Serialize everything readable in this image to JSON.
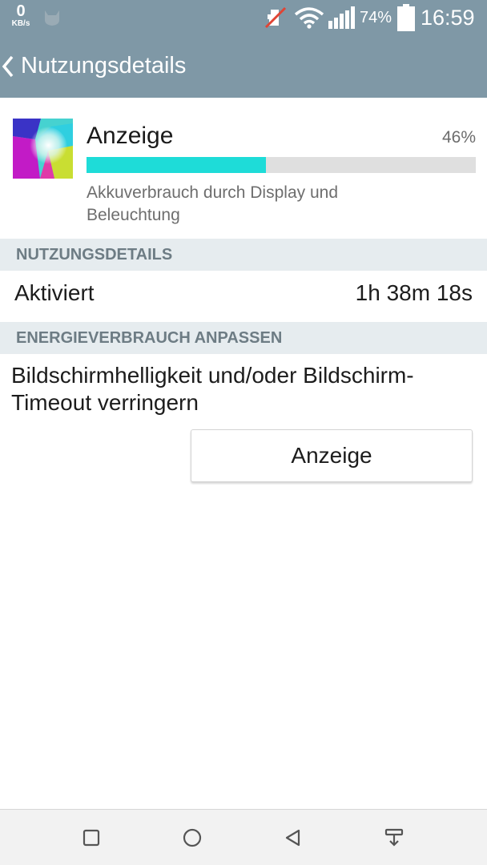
{
  "status_bar": {
    "speed_value": "0",
    "speed_unit": "KB/s",
    "battery_percent": "74%",
    "time": "16:59",
    "icons": [
      "cat-icon",
      "mute-icon",
      "wifi-icon",
      "signal-icon",
      "battery-icon"
    ]
  },
  "app_bar": {
    "title": "Nutzungsdetails",
    "back_icon": "back-icon"
  },
  "usage": {
    "icon": "display-app-icon",
    "title": "Anzeige",
    "percent_label": "46%",
    "percent_value": 46,
    "description": "Akkuverbrauch durch Display und Beleuchtung"
  },
  "sections": {
    "details_header": "NUTZUNGSDETAILS",
    "active_label": "Aktiviert",
    "active_value": "1h 38m 18s",
    "energy_header": "ENERGIEVERBRAUCH ANPASSEN",
    "hint": "Bildschirmhelligkeit und/oder Bildschirm-Timeout verringern",
    "button_label": "Anzeige"
  },
  "nav_bar": {
    "icons": [
      "recent-apps-icon",
      "home-icon",
      "back-nav-icon",
      "notification-pull-icon"
    ]
  },
  "colors": {
    "app_bar": "#7f98a6",
    "progress_fill": "#1edcd8",
    "progress_track": "#dfdfdf",
    "section_header_bg": "#e6ecef",
    "section_header_text": "#6d7c84",
    "nav_bar_bg": "#f2f2f2"
  }
}
